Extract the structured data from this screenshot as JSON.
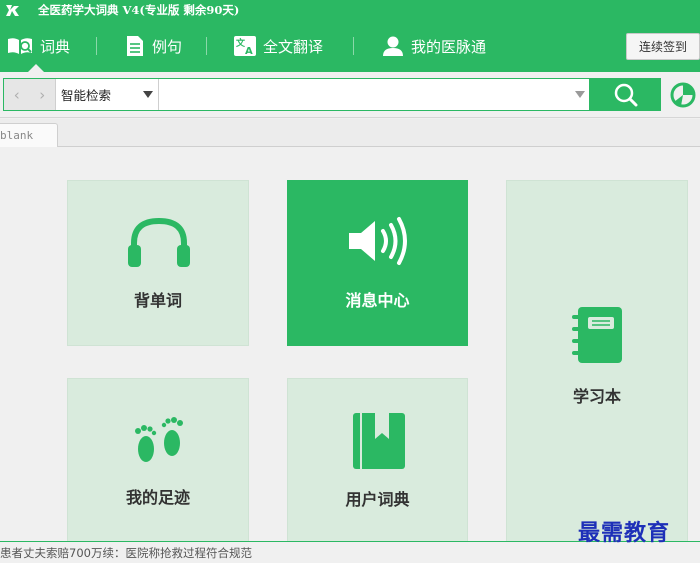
{
  "window": {
    "title": "全医药学大词典 V4(专业版 剩余90天)",
    "logo_text": "ℸ"
  },
  "nav": {
    "items": [
      {
        "label": "词典",
        "icon": "dictionary-icon"
      },
      {
        "label": "例句",
        "icon": "document-icon"
      },
      {
        "label": "全文翻译",
        "icon": "translate-icon"
      },
      {
        "label": "我的医脉通",
        "icon": "user-icon"
      }
    ],
    "signin_label": "连续签到"
  },
  "search": {
    "back_arrow": "‹",
    "forward_arrow": "›",
    "mode": "智能检索",
    "value": "",
    "search_icon": "search-icon",
    "extra_icon": "pie-chart-icon"
  },
  "tabs": [
    {
      "label": "blank"
    }
  ],
  "tiles": [
    {
      "label": "背单词",
      "icon": "headphones-icon",
      "active": false
    },
    {
      "label": "消息中心",
      "icon": "speaker-icon",
      "active": true
    },
    {
      "label": "学习本",
      "icon": "notebook-icon",
      "active": false
    },
    {
      "label": "我的足迹",
      "icon": "footprints-icon",
      "active": false
    },
    {
      "label": "用户词典",
      "icon": "bookmark-book-icon",
      "active": false
    }
  ],
  "status": {
    "ticker": "患者丈夫索赔700万续：医院称抢救过程符合规范"
  },
  "watermark": "最需教育",
  "colors": {
    "accent": "#2bb863",
    "tile_bg": "#d9ebdd"
  }
}
